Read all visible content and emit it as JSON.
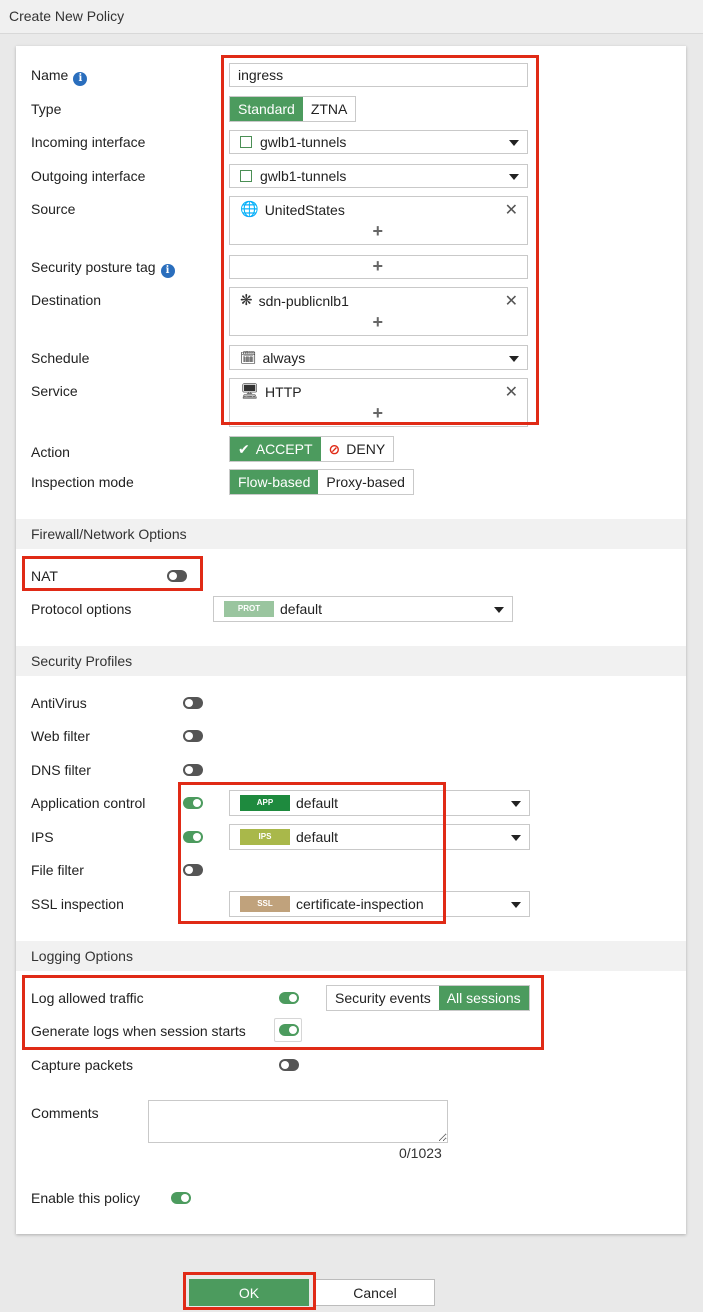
{
  "window": {
    "title": "Create New Policy"
  },
  "form": {
    "name": {
      "label": "Name",
      "value": "ingress"
    },
    "type": {
      "label": "Type",
      "options": [
        "Standard",
        "ZTNA"
      ],
      "selected": "Standard"
    },
    "incoming": {
      "label": "Incoming interface",
      "value": "gwlb1-tunnels"
    },
    "outgoing": {
      "label": "Outgoing interface",
      "value": "gwlb1-tunnels"
    },
    "source": {
      "label": "Source",
      "value": "UnitedStates"
    },
    "posture": {
      "label": "Security posture tag"
    },
    "destination": {
      "label": "Destination",
      "value": "sdn-publicnlb1"
    },
    "schedule": {
      "label": "Schedule",
      "value": "always"
    },
    "service": {
      "label": "Service",
      "value": "HTTP"
    },
    "action": {
      "label": "Action",
      "accept": "ACCEPT",
      "deny": "DENY"
    },
    "inspection": {
      "label": "Inspection mode",
      "options": [
        "Flow-based",
        "Proxy-based"
      ],
      "selected": "Flow-based"
    }
  },
  "firewall": {
    "title": "Firewall/Network Options",
    "nat": {
      "label": "NAT",
      "enabled": false
    },
    "protocol": {
      "label": "Protocol options",
      "badge": "PROT",
      "value": "default"
    }
  },
  "profiles": {
    "title": "Security Profiles",
    "antivirus": {
      "label": "AntiVirus",
      "enabled": false
    },
    "webfilter": {
      "label": "Web filter",
      "enabled": false
    },
    "dnsfilter": {
      "label": "DNS filter",
      "enabled": false
    },
    "appcontrol": {
      "label": "Application control",
      "enabled": true,
      "badge": "APP",
      "value": "default"
    },
    "ips": {
      "label": "IPS",
      "enabled": true,
      "badge": "IPS",
      "value": "default"
    },
    "filefilter": {
      "label": "File filter",
      "enabled": false
    },
    "ssl": {
      "label": "SSL inspection",
      "badge": "SSL",
      "value": "certificate-inspection"
    }
  },
  "logging": {
    "title": "Logging Options",
    "allowed": {
      "label": "Log allowed traffic",
      "enabled": true,
      "options": [
        "Security events",
        "All sessions"
      ],
      "selected": "All sessions"
    },
    "session_start": {
      "label": "Generate logs when session starts",
      "enabled": true
    },
    "capture": {
      "label": "Capture packets",
      "enabled": false
    },
    "comments": {
      "label": "Comments",
      "counter": "0/1023"
    },
    "enable_policy": {
      "label": "Enable this policy",
      "enabled": true
    }
  },
  "buttons": {
    "ok": "OK",
    "cancel": "Cancel"
  },
  "colors": {
    "accent": "#4c9b5e",
    "highlight": "#e02a16",
    "app_badge": "#1e8a3e",
    "ips_badge": "#a9b84a",
    "ssl_badge": "#c0a27c",
    "prot_badge": "#9ac59f"
  }
}
